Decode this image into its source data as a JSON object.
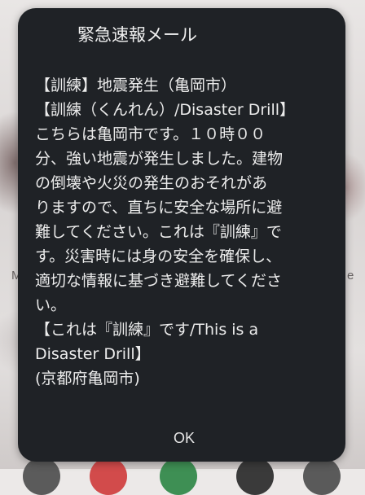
{
  "dialog": {
    "title": "緊急速報メール",
    "body": "【訓練】地震発生（亀岡市）\n【訓練（くんれん）/Disaster Drill】\nこちらは亀岡市です。１０時００\n分、強い地震が発生しました。建物\nの倒壊や火災の発生のおそれがあ\nりますので、直ちに安全な場所に避\n難してください。これは『訓練』で\nす。災害時には身の安全を確保し、\n適切な情報に基づき避難してくださ\nい。\n【これは『訓練』です/This is a\nDisaster Drill】\n(京都府亀岡市)",
    "ok_label": "OK"
  },
  "background": {
    "left_letter": "M",
    "right_letter": "e"
  },
  "colors": {
    "dialog_background": "#1f2226",
    "dialog_text": "#ececec",
    "wallpaper": "#e3e0df"
  }
}
